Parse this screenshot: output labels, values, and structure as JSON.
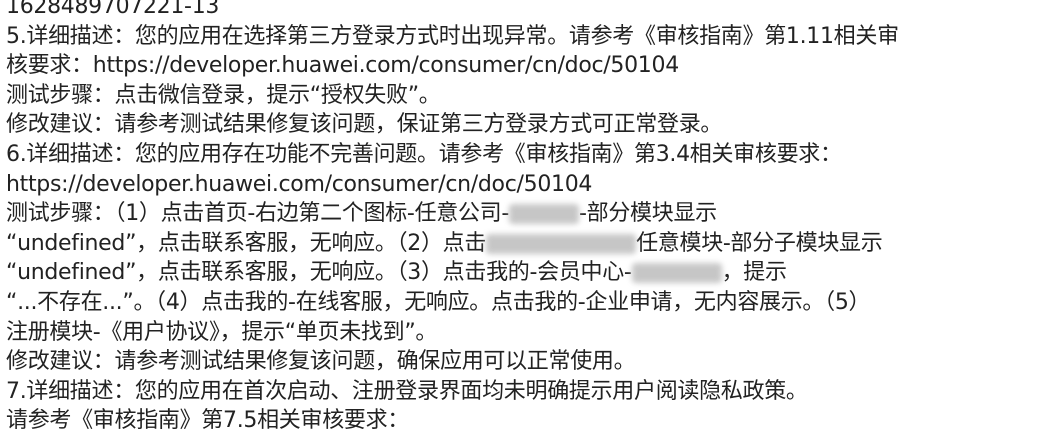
{
  "lines": [
    "1628489707221-13",
    "5.详细描述：您的应用在选择第三方登录方式时出现异常。请参考《审核指南》第1.11相关审",
    "核要求：https://developer.huawei.com/consumer/cn/doc/50104",
    "测试步骤：点击微信登录，提示“授权失败”。",
    "修改建议：请参考测试结果修复该问题，保证第三方登录方式可正常登录。",
    "6.详细描述：您的应用存在功能不完善问题。请参考《审核指南》第3.4相关审核要求：",
    "https://developer.huawei.com/consumer/cn/doc/50104"
  ],
  "l8": {
    "a": "测试步骤：（1）点击首页-右边第二个图标-任意公司-",
    "b": "-部分模块显示"
  },
  "l9": {
    "a": "“undefined”，点击联系客服，无响应。（2）点击",
    "b": "任意模块-部分子模块显示"
  },
  "l10": {
    "a": "“undefined”，点击联系客服，无响应。（3）点击我的-会员中心-",
    "b": "，提示"
  },
  "l11": "“...不存在...”。（4）点击我的-在线客服，无响应。点击我的-企业申请，无内容展示。（5）",
  "l12": "注册模块-《用户协议》，提示“单页未找到”。",
  "l13": "修改建议：请参考测试结果修复该问题，确保应用可以正常使用。",
  "l14": "7.详细描述：您的应用在首次启动、注册登录界面均未明确提示用户阅读隐私政策。",
  "l15": "请参考《审核指南》第7.5相关审核要求："
}
